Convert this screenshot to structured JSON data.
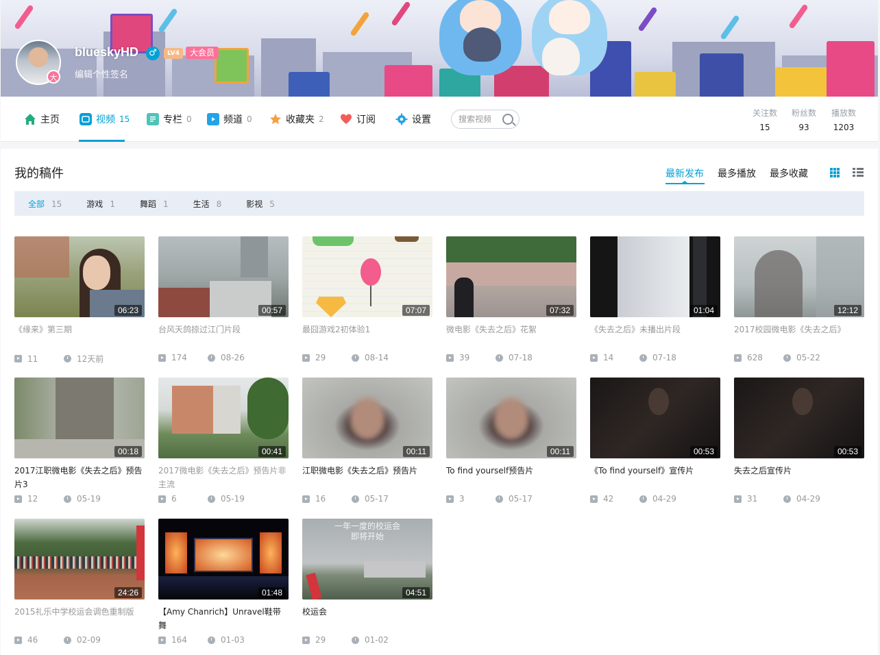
{
  "user": {
    "name": "blueskyHD",
    "level": "LV4",
    "vip": "大会员",
    "avatar_badge": "大",
    "signature": "编辑个性签名"
  },
  "nav": {
    "items": [
      {
        "label": "主页",
        "count": "",
        "icon": "home-icon",
        "color": "#23ad7f"
      },
      {
        "label": "视频",
        "count": "15",
        "icon": "video-icon",
        "color": "#00a1d6"
      },
      {
        "label": "专栏",
        "count": "0",
        "icon": "article-icon",
        "color": "#4fc3b7"
      },
      {
        "label": "频道",
        "count": "0",
        "icon": "channel-icon",
        "color": "#23a3e8"
      },
      {
        "label": "收藏夹",
        "count": "2",
        "icon": "favorites-star-icon",
        "color": "#f6a043"
      },
      {
        "label": "订阅",
        "count": "",
        "icon": "heart-icon",
        "color": "#f25d59"
      },
      {
        "label": "设置",
        "count": "",
        "icon": "gear-icon",
        "color": "#23a3e8"
      }
    ],
    "search_placeholder": "搜索视频"
  },
  "stats": [
    {
      "label": "关注数",
      "value": "15"
    },
    {
      "label": "粉丝数",
      "value": "93"
    },
    {
      "label": "播放数",
      "value": "1203"
    }
  ],
  "section": {
    "title": "我的稿件",
    "sorts": [
      "最新发布",
      "最多播放",
      "最多收藏"
    ]
  },
  "filters": [
    {
      "label": "全部",
      "count": "15"
    },
    {
      "label": "游戏",
      "count": "1"
    },
    {
      "label": "舞蹈",
      "count": "1"
    },
    {
      "label": "生活",
      "count": "8"
    },
    {
      "label": "影视",
      "count": "5"
    }
  ],
  "videos": [
    {
      "title": "《缘来》第三期",
      "duration": "06:23",
      "plays": "11",
      "date": "12天前"
    },
    {
      "title": "台风天鸽掠过江门片段",
      "duration": "00:57",
      "plays": "174",
      "date": "08-26"
    },
    {
      "title": "最囧游戏2初体验1",
      "duration": "07:07",
      "plays": "29",
      "date": "08-14"
    },
    {
      "title": "微电影《失去之后》花絮",
      "duration": "07:32",
      "plays": "39",
      "date": "07-18"
    },
    {
      "title": "《失去之后》未播出片段",
      "duration": "01:04",
      "plays": "14",
      "date": "07-18"
    },
    {
      "title": "2017校园微电影《失去之后》",
      "duration": "12:12",
      "plays": "628",
      "date": "05-22"
    },
    {
      "title": "2017江职微电影《失去之后》预告片3",
      "duration": "00:18",
      "plays": "12",
      "date": "05-19"
    },
    {
      "title": "2017微电影《失去之后》预告片非主流",
      "duration": "00:41",
      "plays": "6",
      "date": "05-19"
    },
    {
      "title": "江职微电影《失去之后》预告片",
      "duration": "00:11",
      "plays": "16",
      "date": "05-17"
    },
    {
      "title": "To find yourself预告片",
      "duration": "00:11",
      "plays": "3",
      "date": "05-17"
    },
    {
      "title": "《To find yourself》宣传片",
      "duration": "00:53",
      "plays": "42",
      "date": "04-29"
    },
    {
      "title": "失去之后宣传片",
      "duration": "00:53",
      "plays": "31",
      "date": "04-29"
    },
    {
      "title": "2015礼乐中学校运会调色重制版",
      "duration": "24:26",
      "plays": "46",
      "date": "02-09"
    },
    {
      "title": "【Amy Chanrich】Unravel鞋带舞",
      "duration": "01:48",
      "plays": "164",
      "date": "01-03"
    },
    {
      "title": "校运会",
      "duration": "04:51",
      "plays": "29",
      "date": "01-02"
    }
  ],
  "thumb_text": {
    "line1": "一年一度的校运会",
    "line2": "即将开始"
  }
}
